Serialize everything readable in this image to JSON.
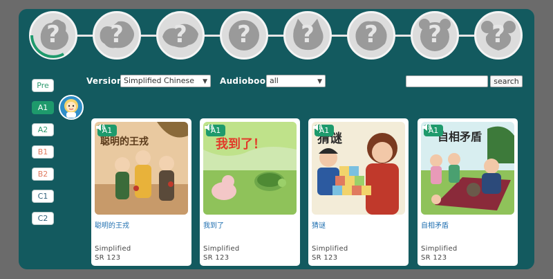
{
  "progress": {
    "animals": [
      {
        "name": "animal-1",
        "label": "?"
      },
      {
        "name": "animal-2",
        "label": "?"
      },
      {
        "name": "animal-3",
        "label": "?"
      },
      {
        "name": "animal-4",
        "label": "?"
      },
      {
        "name": "animal-5",
        "label": "?"
      },
      {
        "name": "animal-6",
        "label": "?"
      },
      {
        "name": "animal-7",
        "label": "?"
      },
      {
        "name": "animal-8",
        "label": "?"
      }
    ]
  },
  "levels": [
    "Pre",
    "A1",
    "A2",
    "B1",
    "B2",
    "C1",
    "C2"
  ],
  "active_level": "A1",
  "filters": {
    "version_label": "Version",
    "version_value": "Simplified Chinese",
    "audiobook_label": "Audiobook",
    "audiobook_value": "all",
    "search_button": "search",
    "search_value": ""
  },
  "books": [
    {
      "level": "A1",
      "title": "聪明的王戎",
      "cover_title": "聪明的王戎",
      "script": "Simplified",
      "serial": "SR 123",
      "icon": "speaker-icon"
    },
    {
      "level": "A1",
      "title": "我到了",
      "cover_title": "我到了！",
      "script": "Simplified",
      "serial": "SR 123",
      "icon": "speaker-icon"
    },
    {
      "level": "A1",
      "title": "猜谜",
      "cover_title": "猜谜",
      "script": "Simplified",
      "serial": "SR 123",
      "icon": "speaker-icon"
    },
    {
      "level": "A1",
      "title": "自相矛盾",
      "cover_title": "自相矛盾",
      "script": "Simplified",
      "serial": "SR 123",
      "icon": "speaker-icon"
    }
  ],
  "colors": {
    "frame": "#135a5f",
    "accent_green": "#1e9a6c",
    "title_blue": "#1f6fb0",
    "outer": "#6b6b6b"
  }
}
